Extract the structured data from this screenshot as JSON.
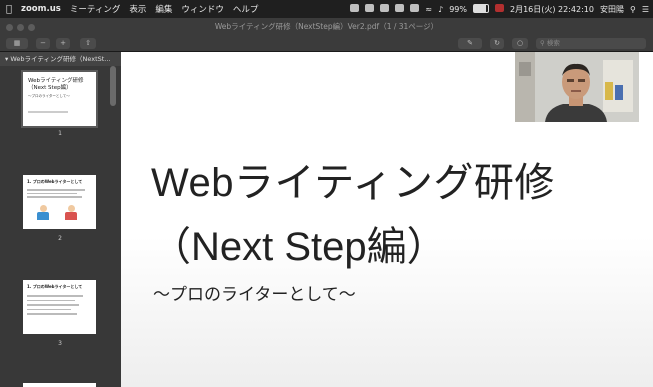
{
  "menubar": {
    "app": "zoom.us",
    "items": [
      "ミーティング",
      "表示",
      "編集",
      "ウィンドウ",
      "ヘルプ"
    ],
    "battery": "99%",
    "datetime": "2月16日(火) 22:42:10",
    "user": "安田陽"
  },
  "window": {
    "title": "Webライティング研修（NextStep編）Ver2.pdf（1 / 31ページ）",
    "search_placeholder": "検索"
  },
  "sidebar": {
    "header": "Webライティング研修（NextSt...",
    "pages": [
      {
        "number": "1",
        "title": "Webライティング研修\n（Next Step編）",
        "subtitle": "～プロのライターとして～"
      },
      {
        "number": "2",
        "title": "1. プロのWebライターとして"
      },
      {
        "number": "3",
        "title": "1. プロのWebライターとして"
      }
    ]
  },
  "slide": {
    "title_line1": "Webライティング研修",
    "title_line2": "（Next Step編）",
    "subtitle": "～プロのライターとして～"
  }
}
